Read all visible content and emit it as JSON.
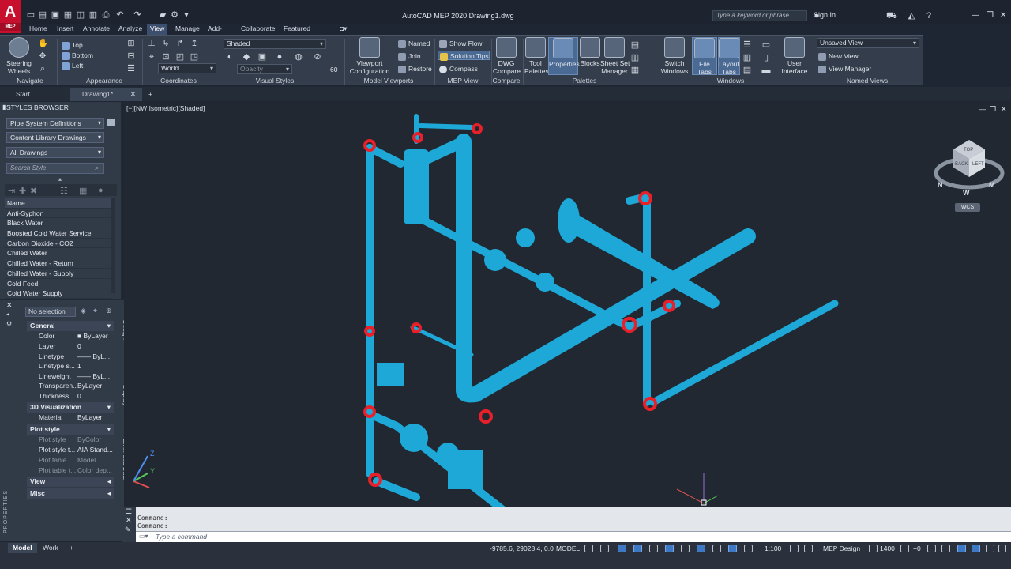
{
  "app": {
    "logo_letter": "A",
    "logo_sub": "MEP",
    "window_title": "AutoCAD MEP 2020   Drawing1.dwg",
    "search_placeholder": "Type a keyword or phrase",
    "sign_in": "Sign In"
  },
  "ribbon_tabs": [
    "Home",
    "Insert",
    "Annotate",
    "Analyze",
    "View",
    "Manage",
    "Add-ins",
    "Collaborate",
    "Featured Apps"
  ],
  "ribbon_active_tab": "View",
  "ribbon": {
    "navigate": {
      "title": "Navigate",
      "steering": "Steering\nWheels"
    },
    "appearance": {
      "title": "Appearance",
      "top": "Top",
      "bottom": "Bottom",
      "left": "Left"
    },
    "coordinates": {
      "title": "Coordinates",
      "world": "World"
    },
    "visual_styles": {
      "title": "Visual Styles",
      "style": "Shaded",
      "opacity_placeholder": "Opacity",
      "opacity_value": "60"
    },
    "model_viewports": {
      "title": "Model Viewports",
      "config": "Viewport\nConfiguration",
      "named": "Named",
      "join": "Join",
      "restore": "Restore"
    },
    "mep_view": {
      "title": "MEP View",
      "show_flow": "Show Flow",
      "solution_tips": "Solution Tips",
      "compass": "Compass"
    },
    "compare": {
      "title": "Compare",
      "dwg_compare": "DWG\nCompare"
    },
    "palettes": {
      "title": "Palettes",
      "tool_palettes": "Tool\nPalettes",
      "properties": "Properties",
      "blocks": "Blocks",
      "sheet_set": "Sheet Set\nManager"
    },
    "windows": {
      "title": "Windows",
      "switch": "Switch\nWindows",
      "file_tabs": "File Tabs",
      "layout_tabs": "Layout\nTabs",
      "user_interface": "User\nInterface"
    },
    "named_views": {
      "title": "Named Views",
      "unsaved": "Unsaved View",
      "new_view": "New View",
      "view_manager": "View Manager"
    }
  },
  "doc_tabs": [
    {
      "label": "Start"
    },
    {
      "label": "Drawing1*"
    }
  ],
  "styles_browser": {
    "title": "STYLES BROWSER",
    "filter1": "Pipe System Definitions",
    "filter2": "Content Library Drawings",
    "filter3": "All Drawings",
    "search_placeholder": "Search Style",
    "list_header": "Name",
    "items": [
      "Anti-Syphon",
      "Black Water",
      "Boosted Cold Water Service",
      "Carbon Dioxide - CO2",
      "Chilled Water",
      "Chilled Water - Return",
      "Chilled Water - Supply",
      "Cold Feed",
      "Cold Water Supply"
    ]
  },
  "properties": {
    "selection": "No selection",
    "palette_label": "PROPERTIES",
    "side_tabs": [
      "Design",
      "Display",
      "Extended Data"
    ],
    "general": {
      "title": "General",
      "rows": [
        {
          "k": "Color",
          "v": "■ ByLayer"
        },
        {
          "k": "Layer",
          "v": "0"
        },
        {
          "k": "Linetype",
          "v": "—— ByL..."
        },
        {
          "k": "Linetype s...",
          "v": "1"
        },
        {
          "k": "Lineweight",
          "v": "—— ByL..."
        },
        {
          "k": "Transparen...",
          "v": "ByLayer"
        },
        {
          "k": "Thickness",
          "v": "0"
        }
      ]
    },
    "vis3d": {
      "title": "3D Visualization",
      "rows": [
        {
          "k": "Material",
          "v": "ByLayer"
        }
      ]
    },
    "plot": {
      "title": "Plot style",
      "rows": [
        {
          "k": "Plot style",
          "v": "ByColor"
        },
        {
          "k": "Plot style t...",
          "v": "AIA Stand..."
        },
        {
          "k": "Plot table...",
          "v": "Model"
        },
        {
          "k": "Plot table t...",
          "v": "Color dep..."
        }
      ]
    },
    "view": "View",
    "misc": "Misc"
  },
  "viewport": {
    "label": "[−][NW Isometric][Shaded]",
    "wcs": "WCS",
    "cube_top": "TOP",
    "cube_left": "BACK",
    "cube_right": "LEFT",
    "compass_n": "N",
    "compass_w": "W",
    "compass_m": "M",
    "ucs_y": "Y",
    "ucs_z": "Z",
    "pipe_color": "#1ea8d8",
    "joint_color": "#e8202a"
  },
  "command": {
    "history": [
      "Command:",
      "Command:"
    ],
    "placeholder": "Type a command"
  },
  "status": {
    "model_tab": "Model",
    "work_tab": "Work",
    "coords": "-9785.6, 29028.4, 0.0",
    "model_label": "MODEL",
    "scale": "1:100",
    "workspace": "MEP Design",
    "elevation": "1400",
    "offset": "+0"
  }
}
